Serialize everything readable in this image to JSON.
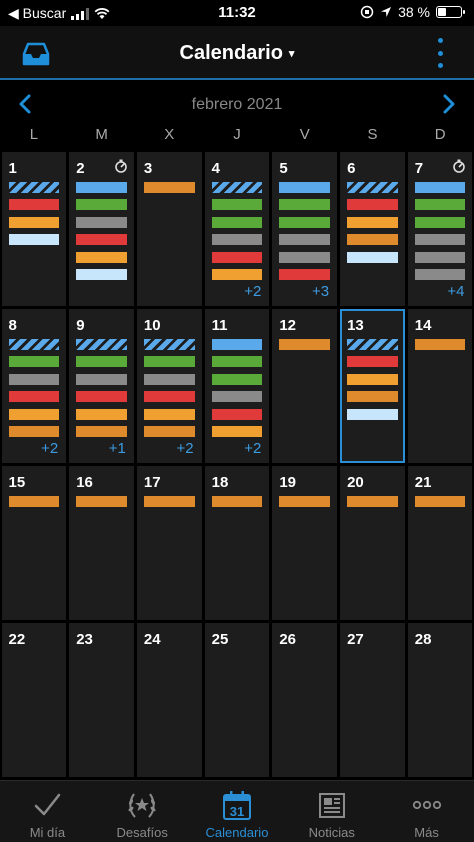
{
  "status_bar": {
    "back_label": "◀ Buscar",
    "time": "11:32",
    "battery_text": "38 %",
    "battery_level": 0.38
  },
  "header": {
    "title": "Calendario",
    "title_caret": "▾"
  },
  "month_nav": {
    "label": "febrero 2021"
  },
  "weekdays": [
    "L",
    "M",
    "X",
    "J",
    "V",
    "S",
    "D"
  ],
  "colors": {
    "blue": "#5aa9ea",
    "green": "#5aaa3a",
    "orange": "#e08a2e",
    "red": "#e03a3a",
    "yellow": "#f0a030",
    "gray": "#8a8a8a",
    "lightblue": "#c8e6fb",
    "striped": "striped",
    "accent": "#2b8fd6"
  },
  "today": "13",
  "days": [
    {
      "day": "1",
      "bars": [
        "striped",
        "red",
        "yellow",
        "lightblue"
      ],
      "more": "",
      "icon": ""
    },
    {
      "day": "2",
      "bars": [
        "blue",
        "green",
        "gray",
        "red",
        "yellow",
        "lightblue"
      ],
      "more": "",
      "icon": "stopwatch-icon"
    },
    {
      "day": "3",
      "bars": [
        "orange"
      ],
      "more": "",
      "icon": ""
    },
    {
      "day": "4",
      "bars": [
        "striped",
        "green",
        "green",
        "gray",
        "red",
        "yellow"
      ],
      "more": "+2",
      "icon": ""
    },
    {
      "day": "5",
      "bars": [
        "blue",
        "green",
        "green",
        "gray",
        "gray",
        "red"
      ],
      "more": "+3",
      "icon": ""
    },
    {
      "day": "6",
      "bars": [
        "striped",
        "red",
        "yellow",
        "orange",
        "lightblue"
      ],
      "more": "",
      "icon": ""
    },
    {
      "day": "7",
      "bars": [
        "blue",
        "green",
        "green",
        "gray",
        "gray",
        "gray"
      ],
      "more": "+4",
      "icon": "stopwatch-icon"
    },
    {
      "day": "8",
      "bars": [
        "striped",
        "green",
        "gray",
        "red",
        "yellow",
        "orange"
      ],
      "more": "+2",
      "icon": ""
    },
    {
      "day": "9",
      "bars": [
        "striped",
        "green",
        "gray",
        "red",
        "yellow",
        "orange"
      ],
      "more": "+1",
      "icon": ""
    },
    {
      "day": "10",
      "bars": [
        "striped",
        "green",
        "gray",
        "red",
        "yellow",
        "orange"
      ],
      "more": "+2",
      "icon": ""
    },
    {
      "day": "11",
      "bars": [
        "blue",
        "green",
        "green",
        "gray",
        "red",
        "yellow"
      ],
      "more": "+2",
      "icon": ""
    },
    {
      "day": "12",
      "bars": [
        "orange"
      ],
      "more": "",
      "icon": ""
    },
    {
      "day": "13",
      "bars": [
        "striped",
        "red",
        "yellow",
        "orange",
        "lightblue"
      ],
      "more": "",
      "icon": ""
    },
    {
      "day": "14",
      "bars": [
        "orange"
      ],
      "more": "",
      "icon": ""
    },
    {
      "day": "15",
      "bars": [
        "orange"
      ],
      "more": "",
      "icon": ""
    },
    {
      "day": "16",
      "bars": [
        "orange"
      ],
      "more": "",
      "icon": ""
    },
    {
      "day": "17",
      "bars": [
        "orange"
      ],
      "more": "",
      "icon": ""
    },
    {
      "day": "18",
      "bars": [
        "orange"
      ],
      "more": "",
      "icon": ""
    },
    {
      "day": "19",
      "bars": [
        "orange"
      ],
      "more": "",
      "icon": ""
    },
    {
      "day": "20",
      "bars": [
        "orange"
      ],
      "more": "",
      "icon": ""
    },
    {
      "day": "21",
      "bars": [
        "orange"
      ],
      "more": "",
      "icon": ""
    },
    {
      "day": "22",
      "bars": [],
      "more": "",
      "icon": ""
    },
    {
      "day": "23",
      "bars": [],
      "more": "",
      "icon": ""
    },
    {
      "day": "24",
      "bars": [],
      "more": "",
      "icon": ""
    },
    {
      "day": "25",
      "bars": [],
      "more": "",
      "icon": ""
    },
    {
      "day": "26",
      "bars": [],
      "more": "",
      "icon": ""
    },
    {
      "day": "27",
      "bars": [],
      "more": "",
      "icon": ""
    },
    {
      "day": "28",
      "bars": [],
      "more": "",
      "icon": ""
    }
  ],
  "tabs": [
    {
      "label": "Mi día",
      "icon": "check-icon",
      "active": false
    },
    {
      "label": "Desafíos",
      "icon": "laurel-icon",
      "active": false
    },
    {
      "label": "Calendario",
      "icon": "calendar-31-icon",
      "active": true,
      "icon_text": "31"
    },
    {
      "label": "Noticias",
      "icon": "newspaper-icon",
      "active": false
    },
    {
      "label": "Más",
      "icon": "more-dots-icon",
      "active": false
    }
  ]
}
